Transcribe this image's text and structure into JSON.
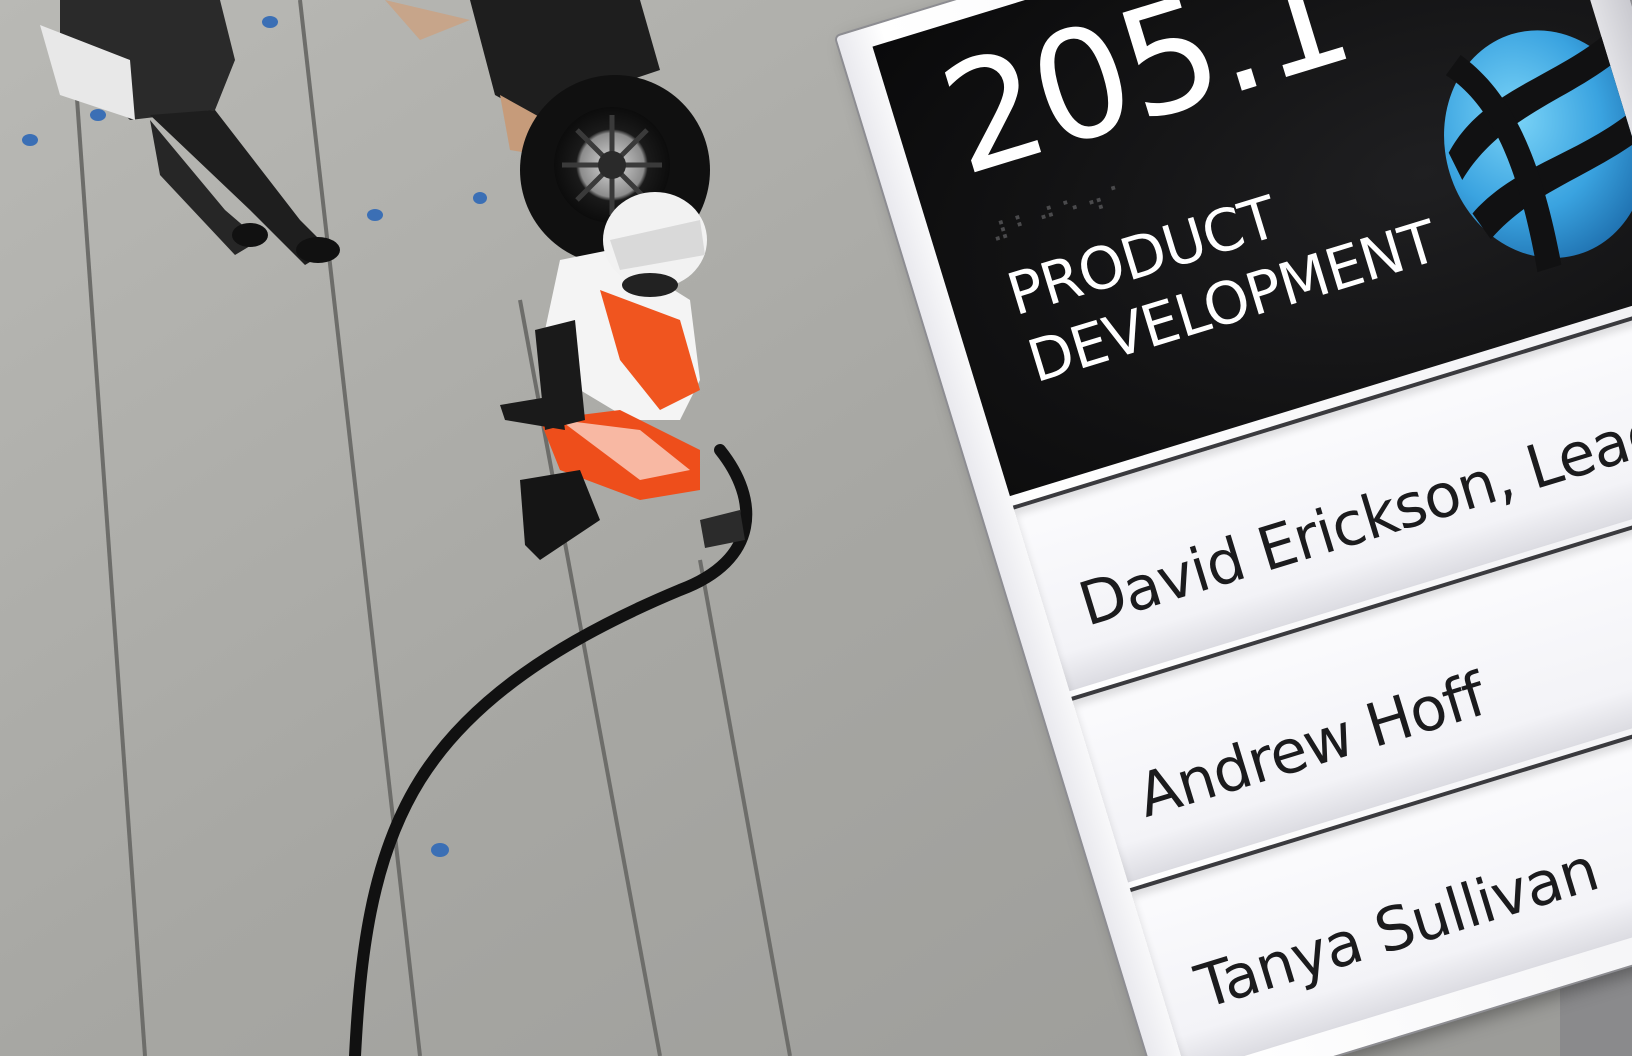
{
  "sign": {
    "room_number": "205.1",
    "braille_text": "⠼⠃⠚⠑⠲⠁",
    "department_line1": "PRODUCT",
    "department_line2": "DEVELOPMENT",
    "names": [
      "David Erickson, Lead",
      "Andrew Hoff",
      "Tanya Sullivan"
    ]
  },
  "colors": {
    "sign_header": "#111112",
    "logo_light": "#5cc2f0",
    "logo_dark": "#1e6fae",
    "suit_orange": "#f0551f",
    "floor": "#a9a9a5"
  },
  "icons": {
    "logo": "sphere-logo-icon"
  }
}
